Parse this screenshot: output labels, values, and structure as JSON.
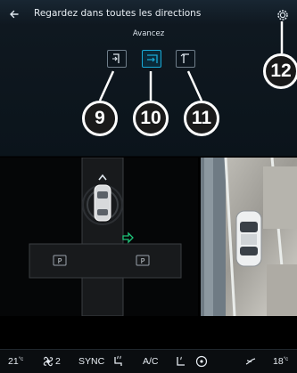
{
  "header": {
    "title": "Regardez dans toutes les directions",
    "icons": {
      "back": "back-arrow-icon",
      "settings": "settings-gear-icon"
    }
  },
  "view_mode": {
    "label": "Avancez",
    "buttons": [
      {
        "icon": "left-corner-view-icon"
      },
      {
        "icon": "front-view-icon",
        "active": true
      },
      {
        "icon": "right-corner-view-icon"
      }
    ]
  },
  "callouts": [
    "9",
    "10",
    "11",
    "12"
  ],
  "parking": {
    "spot_left": "P",
    "spot_right": "P"
  },
  "colors": {
    "accent": "#19a9d6",
    "arrow": "#1ec47a"
  },
  "bottom_bar": {
    "temp_left": "21",
    "temp_left_unit": "°c",
    "fan_level": "2",
    "sync_label": "SYNC",
    "ac_label": "A/C",
    "temp_right": "18",
    "temp_right_unit": "°c",
    "icons": [
      "fan-icon",
      "heated-seat-icon",
      "steering-heat-icon",
      "recirculation-icon",
      "heated-seat-icon",
      "fan-speed-icon"
    ]
  }
}
